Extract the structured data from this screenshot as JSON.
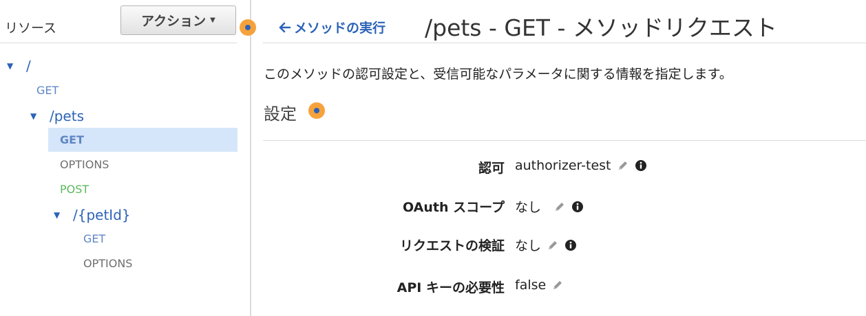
{
  "sidebar": {
    "title": "リソース",
    "action_button": "アクション",
    "tree": {
      "root": "/",
      "root_get": "GET",
      "pets": "/pets",
      "pets_get": "GET",
      "pets_options": "OPTIONS",
      "pets_post": "POST",
      "petid": "/{petId}",
      "petid_get": "GET",
      "petid_options": "OPTIONS"
    }
  },
  "main": {
    "back_link": "メソッドの実行",
    "title": "/pets - GET - メソッドリクエスト",
    "description": "このメソッドの認可設定と、受信可能なパラメータに関する情報を指定します。",
    "section_title": "設定",
    "settings": [
      {
        "label": "認可",
        "value": "authorizer-test"
      },
      {
        "label": "OAuth スコープ",
        "value": "なし"
      },
      {
        "label": "リクエストの検証",
        "value": "なし"
      },
      {
        "label": "API キーの必要性",
        "value": "false"
      }
    ]
  },
  "colors": {
    "link_blue": "#2b63b7",
    "orange_marker": "#f6a23c",
    "selected_bg": "#d6e6fa",
    "post_green": "#5cb85c"
  },
  "icons": [
    "caret-down-icon",
    "arrow-left-icon",
    "pencil-icon",
    "info-icon",
    "marker-dot-icon"
  ]
}
